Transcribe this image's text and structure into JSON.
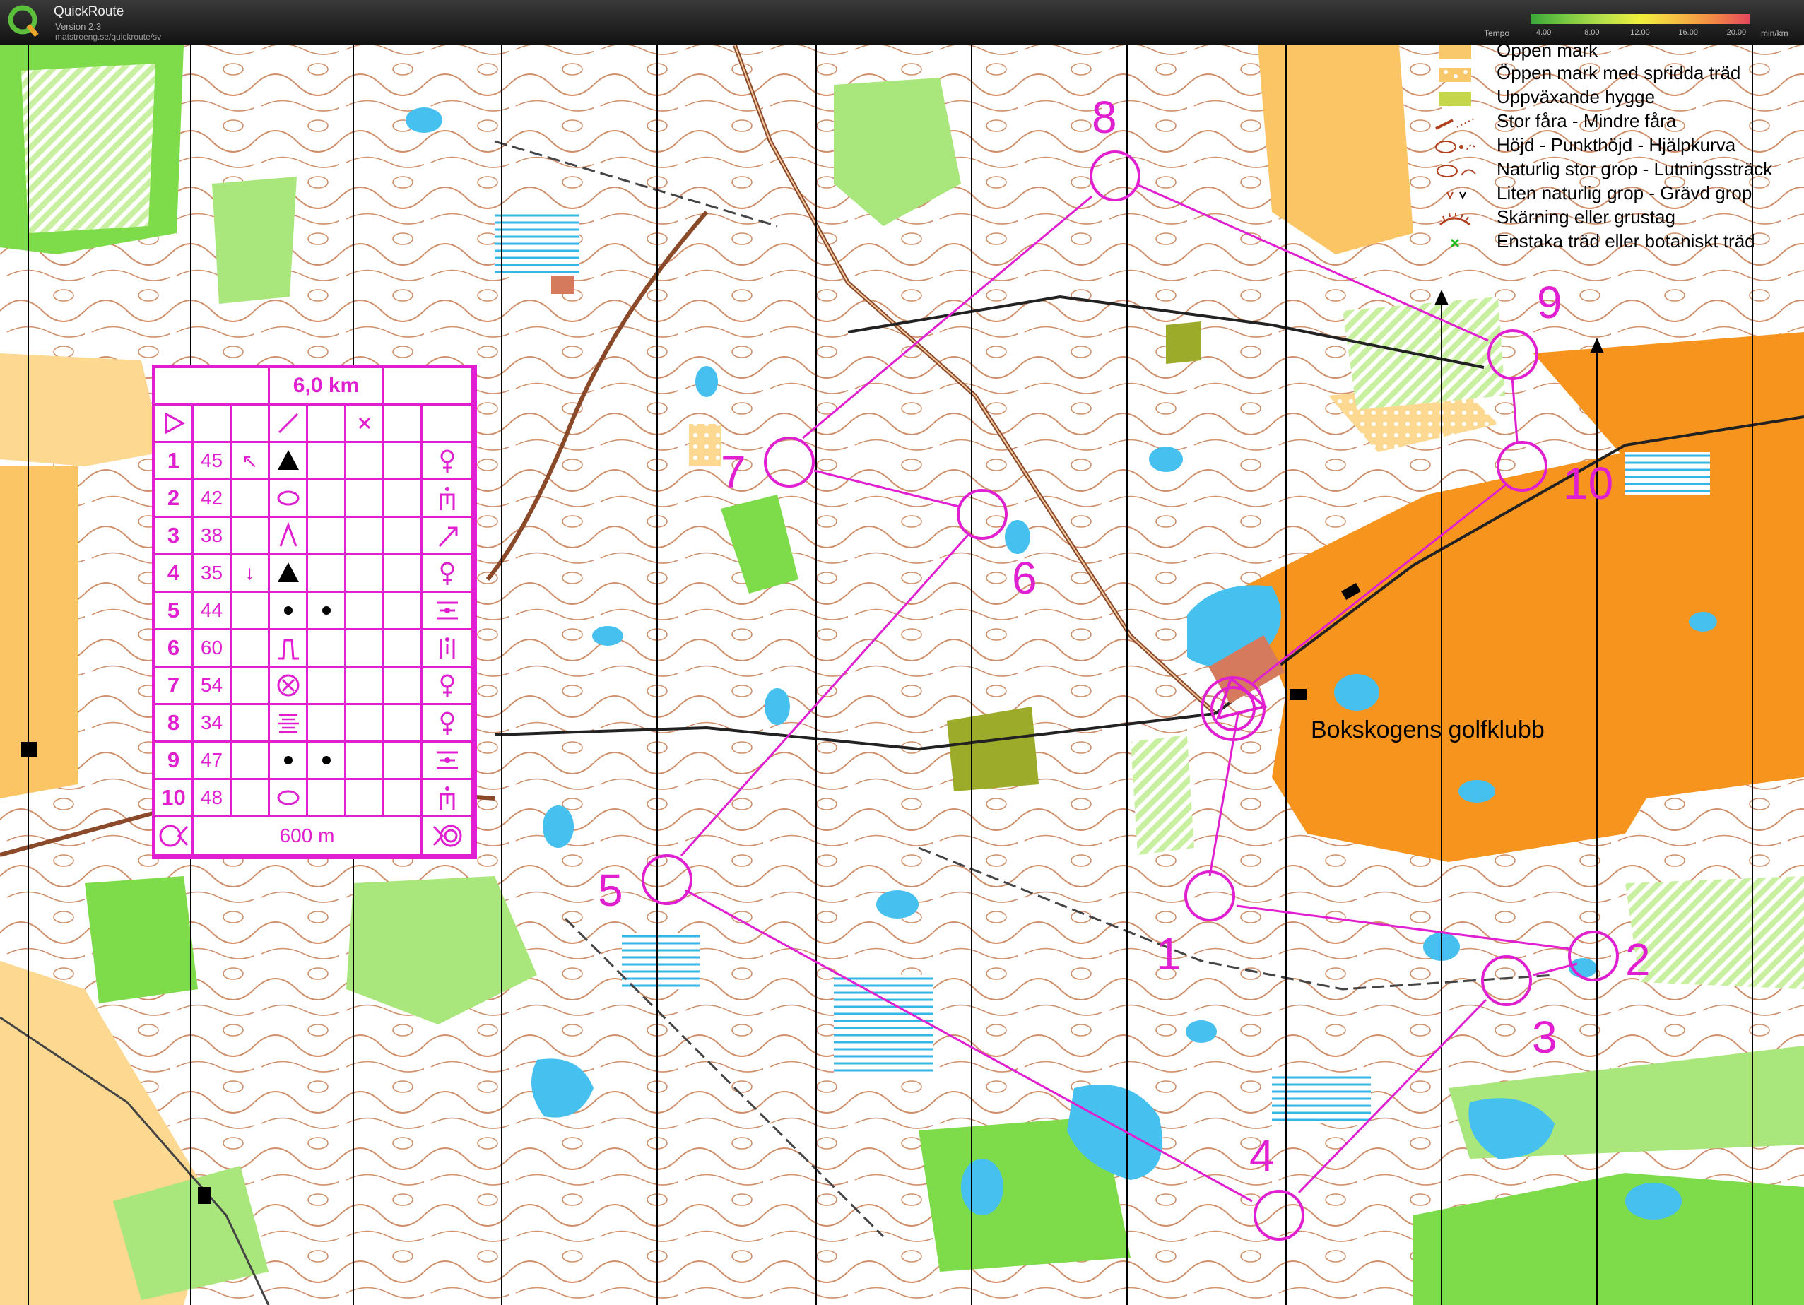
{
  "app": {
    "title": "QuickRoute",
    "version": "Version 2.3",
    "url": "matstroeng.se/quickroute/sv",
    "logo_icon": "quickroute-q-logo-icon"
  },
  "tempo_scale": {
    "label": "Tempo",
    "ticks": [
      "4.00",
      "8.00",
      "12.00",
      "16.00",
      "20.00"
    ],
    "unit": "min/km",
    "colors": [
      "#3aa63a",
      "#7ac943",
      "#b7e04a",
      "#f0ef3c",
      "#f6c043",
      "#f28a46",
      "#e5485a"
    ]
  },
  "legend": [
    {
      "label": "Öppen mark",
      "symbol": "open-land-swatch",
      "color": "#f9c86b"
    },
    {
      "label": "Öppen mark med spridda träd",
      "symbol": "open-land-scattered-trees-swatch",
      "color": "#f9c86b"
    },
    {
      "label": "Uppväxande hygge",
      "symbol": "new-growth-swatch",
      "color": "#c5d64a"
    },
    {
      "label": "Stor fåra - Mindre fåra",
      "symbol": "erosion-gully-symbol",
      "color": "#b04020"
    },
    {
      "label": "Höjd - Punkthöjd - Hjälpkurva",
      "symbol": "knoll-contour-symbol",
      "color": "#b04020"
    },
    {
      "label": "Naturlig stor grop - Lutningssträck",
      "symbol": "depression-symbol",
      "color": "#b04020"
    },
    {
      "label": "Liten naturlig grop - Grävd grop",
      "symbol": "pit-symbol",
      "color": "#b04020"
    },
    {
      "label": "Skärning eller grustag",
      "symbol": "quarry-symbol",
      "color": "#b04020"
    },
    {
      "label": "Enstaka träd eller botaniskt träd",
      "symbol": "special-tree-symbol",
      "color": "#22bb22"
    }
  ],
  "course": {
    "color": "#e020d0",
    "controls": [
      "1",
      "2",
      "3",
      "4",
      "5",
      "6",
      "7",
      "8",
      "9",
      "10"
    ]
  },
  "map_labels": {
    "golf_club": "Bokskogens golfklubb"
  },
  "control_descriptions": {
    "course_length": "6,0 km",
    "header_symbols": [
      "start-triangle-icon",
      "slash-icon",
      "cross-icon"
    ],
    "rows": [
      {
        "num": "1",
        "code": "45",
        "dir": "↖",
        "feature": "knoll-triangle-icon",
        "where": "",
        "extra": "",
        "detail": "water-point-icon"
      },
      {
        "num": "2",
        "code": "42",
        "dir": "",
        "feature": "depression-oval-icon",
        "where": "",
        "extra": "",
        "detail": "manned-control-icon"
      },
      {
        "num": "3",
        "code": "38",
        "dir": "",
        "feature": "gully-lambda-icon",
        "where": "",
        "extra": "",
        "detail": "tools-icon"
      },
      {
        "num": "4",
        "code": "35",
        "dir": "↓",
        "feature": "knoll-triangle-icon",
        "where": "",
        "extra": "",
        "detail": "water-point-icon"
      },
      {
        "num": "5",
        "code": "44",
        "dir": "",
        "feature": "small-knoll-dot-icon",
        "where": "small-knoll-dot-icon",
        "extra": "",
        "detail": "between-icon"
      },
      {
        "num": "6",
        "code": "60",
        "dir": "",
        "feature": "spur-icon",
        "where": "",
        "extra": "",
        "detail": "passage-icon"
      },
      {
        "num": "7",
        "code": "54",
        "dir": "",
        "feature": "boulder-cross-circle-icon",
        "where": "",
        "extra": "",
        "detail": "water-point-icon"
      },
      {
        "num": "8",
        "code": "34",
        "dir": "",
        "feature": "marsh-lines-icon",
        "where": "",
        "extra": "",
        "detail": "water-point-icon"
      },
      {
        "num": "9",
        "code": "47",
        "dir": "",
        "feature": "small-knoll-dot-icon",
        "where": "small-knoll-dot-icon",
        "extra": "",
        "detail": "between-icon"
      },
      {
        "num": "10",
        "code": "48",
        "dir": "",
        "feature": "depression-oval-icon",
        "where": "",
        "extra": "",
        "detail": "manned-control-icon"
      }
    ],
    "finish_distance": "600 m",
    "footer_symbols": [
      "last-control-icon",
      "finish-icon"
    ]
  }
}
